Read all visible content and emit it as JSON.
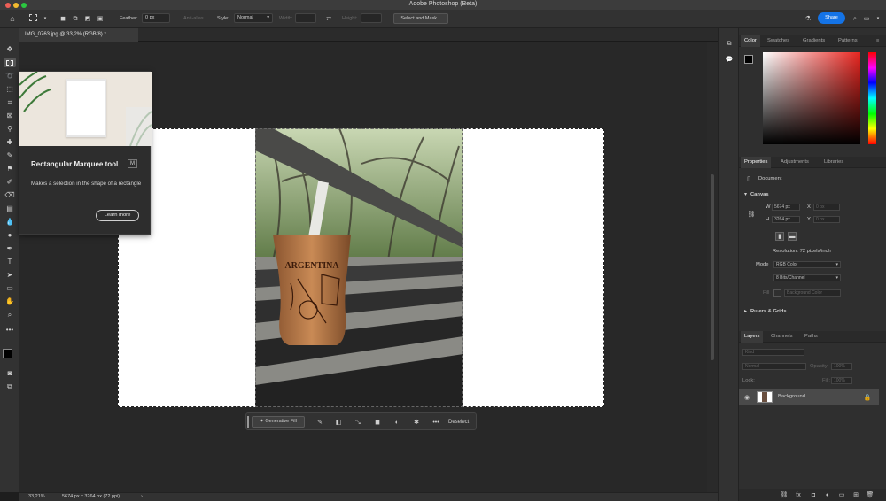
{
  "window": {
    "title": "Adobe Photoshop (Beta)"
  },
  "options_bar": {
    "feather_label": "Feather:",
    "feather_value": "0 px",
    "anti_alias_label": "Anti-alias",
    "style_label": "Style:",
    "style_value": "Normal",
    "width_label": "Width:",
    "height_label": "Height:",
    "select_mask_label": "Select and Mask...",
    "share_label": "Share"
  },
  "document": {
    "tab_label": "IMG_0763.jpg @ 33,2% (RGB/8) *"
  },
  "tooltip": {
    "title": "Rectangular Marquee tool",
    "shortcut": "M",
    "description": "Makes a selection in the shape of a rectangle",
    "learn_more": "Learn more"
  },
  "photo": {
    "mug_text": "ARGENTINA"
  },
  "contextual_bar": {
    "generative_fill": "Generative Fill",
    "more": "•••",
    "deselect": "Deselect"
  },
  "status_bar": {
    "zoom": "33,21%",
    "doc_info": "5674 px x 3264 px (72 ppi)",
    "arrow": "›"
  },
  "color_panel": {
    "tabs": [
      "Color",
      "Swatches",
      "Gradients",
      "Patterns"
    ]
  },
  "properties_panel": {
    "tabs": [
      "Properties",
      "Adjustments",
      "Libraries"
    ],
    "doc_label": "Document",
    "canvas_section": "Canvas",
    "w_label": "W",
    "w_value": "5674 px",
    "h_label": "H",
    "h_value": "3264 px",
    "x_label": "X",
    "x_value": "0 px",
    "y_label": "Y",
    "y_value": "0 px",
    "resolution": "Resolution: 72 pixels/inch",
    "mode_label": "Mode",
    "mode_value": "RGB Color",
    "bits_value": "8 Bits/Channel",
    "fill_label": "Fill",
    "fill_value": "Background Color",
    "rulers_section": "Rulers & Grids"
  },
  "layers_panel": {
    "tabs": [
      "Layers",
      "Channels",
      "Paths"
    ],
    "search_placeholder": "Kind",
    "blend_mode": "Normal",
    "opacity_label": "Opacity:",
    "opacity_value": "100%",
    "lock_label": "Lock:",
    "fill_label": "Fill:",
    "fill_value": "100%",
    "layers": [
      {
        "name": "Background",
        "visible": true,
        "locked": true
      }
    ]
  },
  "colors": {
    "accent": "#1473e6",
    "foreground": "#000000",
    "background": "#ffffff"
  }
}
